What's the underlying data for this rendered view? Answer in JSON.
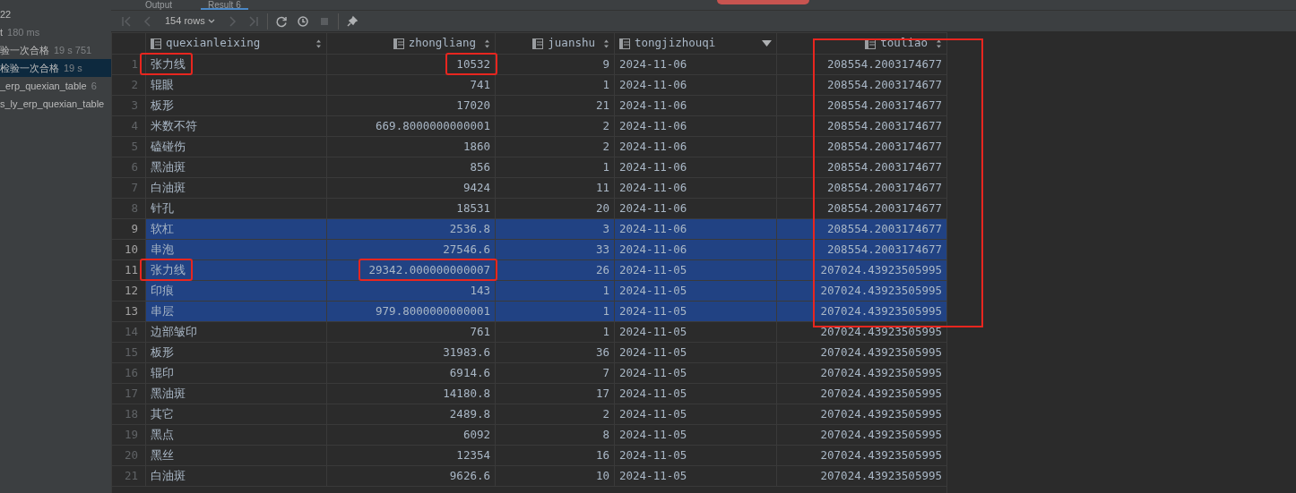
{
  "sidebar": {
    "items": [
      {
        "label": "22",
        "selected": false
      },
      {
        "label": "t",
        "detail": "180 ms",
        "selected": false
      },
      {
        "label": "验一次合格",
        "detail": "19 s 751",
        "selected": false
      },
      {
        "label": "检验一次合格",
        "detail": "19 s",
        "selected": true
      },
      {
        "label": "_erp_quexian_table",
        "detail": "6",
        "selected": false
      },
      {
        "label": "s_ly_erp_quexian_table",
        "selected": false
      }
    ]
  },
  "tabs": [
    {
      "label": "Output",
      "selected": false
    },
    {
      "label": "Result 6",
      "selected": true
    }
  ],
  "toolbar": {
    "row_count": "154 rows"
  },
  "table": {
    "columns": [
      {
        "name": "quexianleixing",
        "kind": "text",
        "sortable": true,
        "boxed": false
      },
      {
        "name": "zhongliang",
        "kind": "number",
        "sortable": true,
        "boxed": false
      },
      {
        "name": "juanshu",
        "kind": "number",
        "sortable": true,
        "boxed": false
      },
      {
        "name": "tongjizhouqi",
        "kind": "date",
        "sortable": false,
        "boxed": false
      },
      {
        "name": "touliao",
        "kind": "number",
        "sortable": true,
        "boxed": true
      }
    ],
    "rows": [
      {
        "number": "1",
        "cells": [
          "张力线",
          "10532",
          "9",
          "2024-11-06",
          "208554.2003174677"
        ],
        "selected": false,
        "boxed": true,
        "in_column_box": true
      },
      {
        "number": "2",
        "cells": [
          "辊眼",
          "741",
          "1",
          "2024-11-06",
          "208554.2003174677"
        ],
        "selected": false,
        "boxed": false,
        "in_column_box": true
      },
      {
        "number": "3",
        "cells": [
          "板形",
          "17020",
          "21",
          "2024-11-06",
          "208554.2003174677"
        ],
        "selected": false,
        "boxed": false,
        "in_column_box": true
      },
      {
        "number": "4",
        "cells": [
          "米数不符",
          "669.8000000000001",
          "2",
          "2024-11-06",
          "208554.2003174677"
        ],
        "selected": false,
        "boxed": false,
        "in_column_box": true
      },
      {
        "number": "5",
        "cells": [
          "磕碰伤",
          "1860",
          "2",
          "2024-11-06",
          "208554.2003174677"
        ],
        "selected": false,
        "boxed": false,
        "in_column_box": true
      },
      {
        "number": "6",
        "cells": [
          "黑油斑",
          "856",
          "1",
          "2024-11-06",
          "208554.2003174677"
        ],
        "selected": false,
        "boxed": false,
        "in_column_box": true
      },
      {
        "number": "7",
        "cells": [
          "白油斑",
          "9424",
          "11",
          "2024-11-06",
          "208554.2003174677"
        ],
        "selected": false,
        "boxed": false,
        "in_column_box": true
      },
      {
        "number": "8",
        "cells": [
          "针孔",
          "18531",
          "20",
          "2024-11-06",
          "208554.2003174677"
        ],
        "selected": false,
        "boxed": false,
        "in_column_box": true
      },
      {
        "number": "9",
        "cells": [
          "软杠",
          "2536.8",
          "3",
          "2024-11-06",
          "208554.2003174677"
        ],
        "selected": true,
        "boxed": false,
        "in_column_box": true
      },
      {
        "number": "10",
        "cells": [
          "串泡",
          "27546.6",
          "33",
          "2024-11-06",
          "208554.2003174677"
        ],
        "selected": true,
        "boxed": false,
        "in_column_box": true
      },
      {
        "number": "11",
        "cells": [
          "张力线",
          "29342.000000000007",
          "26",
          "2024-11-05",
          "207024.43923505995"
        ],
        "selected": true,
        "boxed": true,
        "in_column_box": true
      },
      {
        "number": "12",
        "cells": [
          "印痕",
          "143",
          "1",
          "2024-11-05",
          "207024.43923505995"
        ],
        "selected": true,
        "boxed": false,
        "in_column_box": true
      },
      {
        "number": "13",
        "cells": [
          "串层",
          "979.8000000000001",
          "1",
          "2024-11-05",
          "207024.43923505995"
        ],
        "selected": true,
        "boxed": false,
        "in_column_box": true
      },
      {
        "number": "14",
        "cells": [
          "边部皱印",
          "761",
          "1",
          "2024-11-05",
          "207024.43923505995"
        ],
        "selected": false,
        "boxed": false,
        "in_column_box": false
      },
      {
        "number": "15",
        "cells": [
          "板形",
          "31983.6",
          "36",
          "2024-11-05",
          "207024.43923505995"
        ],
        "selected": false,
        "boxed": false,
        "in_column_box": false
      },
      {
        "number": "16",
        "cells": [
          "辊印",
          "6914.6",
          "7",
          "2024-11-05",
          "207024.43923505995"
        ],
        "selected": false,
        "boxed": false,
        "in_column_box": false
      },
      {
        "number": "17",
        "cells": [
          "黑油斑",
          "14180.8",
          "17",
          "2024-11-05",
          "207024.43923505995"
        ],
        "selected": false,
        "boxed": false,
        "in_column_box": false
      },
      {
        "number": "18",
        "cells": [
          "其它",
          "2489.8",
          "2",
          "2024-11-05",
          "207024.43923505995"
        ],
        "selected": false,
        "boxed": false,
        "in_column_box": false
      },
      {
        "number": "19",
        "cells": [
          "黑点",
          "6092",
          "8",
          "2024-11-05",
          "207024.43923505995"
        ],
        "selected": false,
        "boxed": false,
        "in_column_box": false
      },
      {
        "number": "20",
        "cells": [
          "黑丝",
          "12354",
          "16",
          "2024-11-05",
          "207024.43923505995"
        ],
        "selected": false,
        "boxed": false,
        "in_column_box": false
      },
      {
        "number": "21",
        "cells": [
          "白油斑",
          "9626.6",
          "10",
          "2024-11-05",
          "207024.43923505995"
        ],
        "selected": false,
        "boxed": false,
        "in_column_box": false
      }
    ]
  }
}
